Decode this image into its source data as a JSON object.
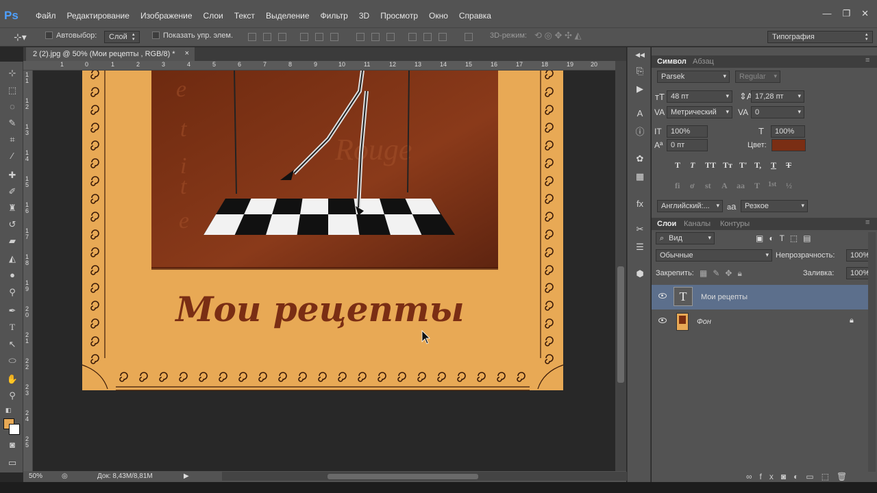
{
  "app": {
    "logo": "Ps"
  },
  "menu": [
    "Файл",
    "Редактирование",
    "Изображение",
    "Слои",
    "Текст",
    "Выделение",
    "Фильтр",
    "3D",
    "Просмотр",
    "Окно",
    "Справка"
  ],
  "window_controls": {
    "minimize": "—",
    "restore": "❐",
    "close": "✕"
  },
  "options": {
    "auto_select_label": "Автовыбор:",
    "auto_select_value": "Слой",
    "show_transform_label": "Показать упр. элем.",
    "mode_3d_label": "3D-режим:",
    "workspace": "Типография"
  },
  "document": {
    "tab_title": "2 (2).jpg @ 50% (Мои рецепты , RGB/8) *",
    "tab_close": "×",
    "title_text": "Мои рецепты",
    "bg_letters": [
      "e",
      "t",
      "i",
      "t",
      "e"
    ],
    "bg_title": "Rouge"
  },
  "ruler": {
    "h_ticks": [
      "1",
      "0",
      "1",
      "2",
      "3",
      "4",
      "5",
      "6",
      "7",
      "8",
      "9",
      "10",
      "11",
      "12",
      "13",
      "14",
      "15",
      "16",
      "17",
      "18",
      "19",
      "20"
    ],
    "v_ticks": [
      "1 1",
      "1 2",
      "1 3",
      "1 4",
      "1 5",
      "1 6",
      "1 7",
      "1 8",
      "1 9",
      "2 0",
      "2 1",
      "2 2",
      "2 3",
      "2 4",
      "2 5"
    ]
  },
  "status": {
    "zoom": "50%",
    "doc_size": "Док: 8,43M/8,81M"
  },
  "character_panel": {
    "tab_active": "Символ",
    "tab_other": "Абзац",
    "font_family": "Parsek",
    "font_style": "Regular",
    "font_size": "48 пт",
    "leading": "17,28 пт",
    "kerning": "Метрический",
    "tracking": "0",
    "vscale": "100%",
    "hscale": "100%",
    "baseline": "0 пт",
    "color_label": "Цвет:",
    "color_value": "#7a2e14",
    "language": "Английский:...",
    "aa_label": "а",
    "aa_prefix": "а",
    "antialias": "Резкое",
    "type_buttons": [
      "T",
      "T",
      "TT",
      "Tт",
      "T'",
      "T,",
      "T",
      "T"
    ],
    "ot_buttons": [
      "fi",
      "ơ",
      "st",
      "A",
      "aa",
      "T",
      "1st",
      "½"
    ]
  },
  "layers_panel": {
    "tabs": [
      "Слои",
      "Каналы",
      "Контуры"
    ],
    "filter_kind": "Вид",
    "blend_mode": "Обычные",
    "opacity_label": "Непрозрачность:",
    "opacity": "100%",
    "lock_label": "Закрепить:",
    "fill_label": "Заливка:",
    "fill": "100%",
    "layers": [
      {
        "name": "Мои рецепты",
        "type": "text",
        "thumb": "T",
        "selected": true
      },
      {
        "name": "Фон",
        "type": "image",
        "locked": true,
        "selected": false
      }
    ]
  },
  "colors": {
    "accent": "#4ea0ff",
    "paper": "#e8a955",
    "title": "#7a2e14",
    "selected_layer": "#5c6f8c"
  }
}
